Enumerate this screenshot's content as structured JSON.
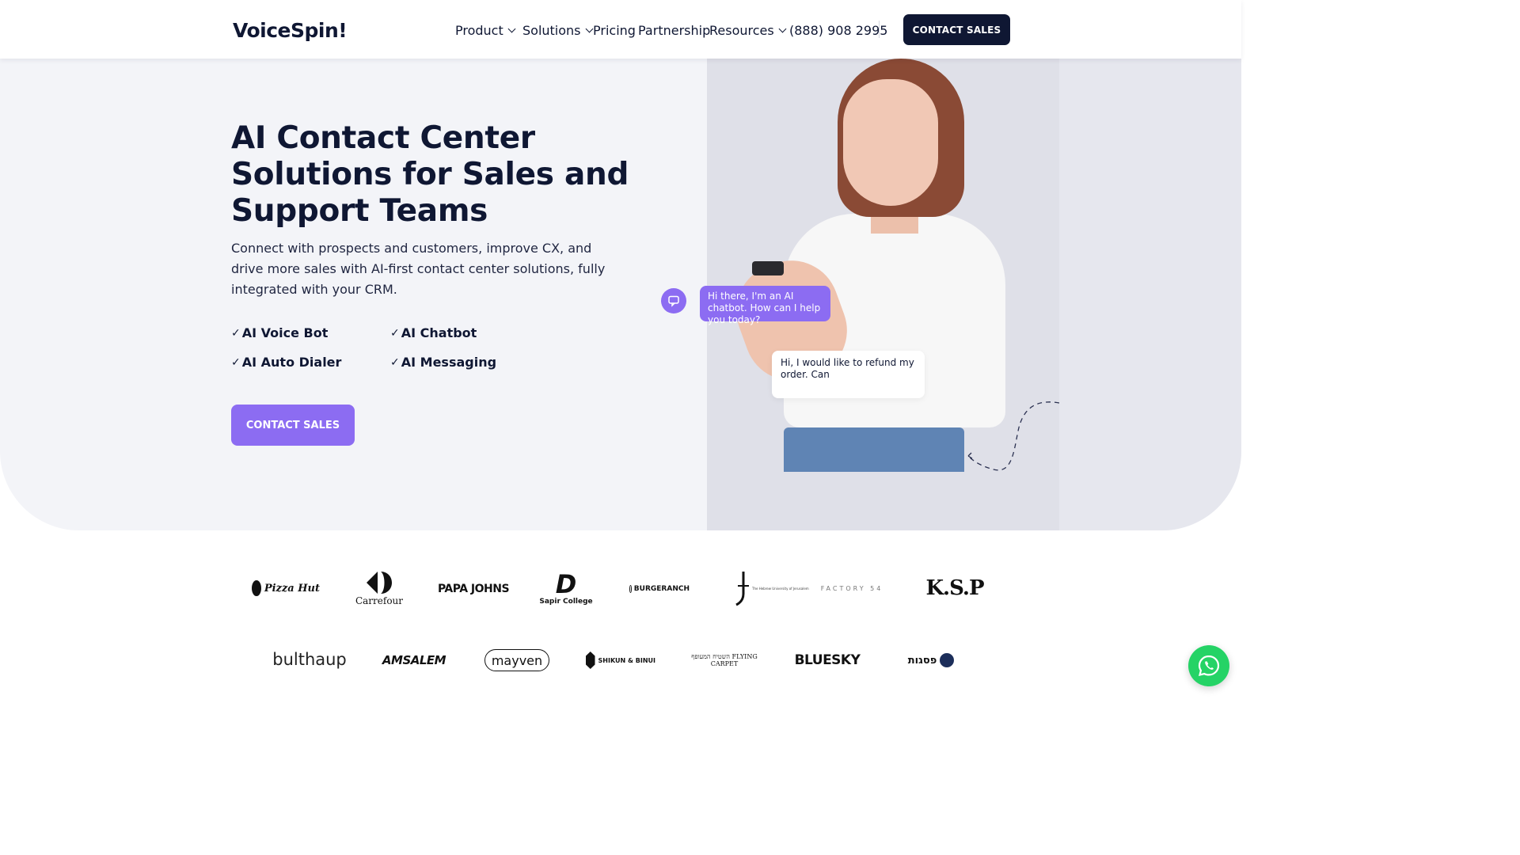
{
  "header": {
    "logo_text": "VoiceSpin!",
    "nav": [
      {
        "label": "Product",
        "has_dropdown": true
      },
      {
        "label": "Solutions",
        "has_dropdown": true
      },
      {
        "label": "Pricing",
        "has_dropdown": false
      },
      {
        "label": "Partnership",
        "has_dropdown": false
      },
      {
        "label": "Resources",
        "has_dropdown": true
      }
    ],
    "phone": "(888) 908 2995",
    "cta_label": "CONTACT SALES"
  },
  "hero": {
    "title": "AI Contact Center Solutions for Sales and Support Teams",
    "subtitle": "Connect with prospects and customers, improve CX, and drive more sales with AI-first contact center solutions, fully integrated with your CRM.",
    "features": [
      "AI Voice Bot",
      "AI Chatbot",
      "AI Auto Dialer",
      "AI Messaging"
    ],
    "check_glyph": "✓",
    "cta_label": "CONTACT SALES",
    "chat": {
      "bot_message": "Hi there, I'm an AI chatbot. How can I help you today?",
      "user_message": "Hi, I would like to refund my order.  Can"
    }
  },
  "clients": {
    "row1": [
      "Pizza Hut",
      "Carrefour",
      "PAPA JOHNS",
      "Sapir College",
      "BURGERANCH",
      "The Hebrew University of Jerusalem",
      "FACTORY 54",
      "K.S.P"
    ],
    "row2": [
      "bulthaup",
      "AMSALEM",
      "mayven",
      "SHIKUN & BINUI",
      "השטיח המעופף FLYING CARPET",
      "BLUESKY",
      "פסגות"
    ]
  },
  "colors": {
    "navy": "#0f1733",
    "purple": "#8c6cf2",
    "hero_bg": "#f3f4f8",
    "whatsapp": "#25d366"
  },
  "icons": {
    "chat": "chat-bubble-icon",
    "whatsapp": "whatsapp-icon",
    "chevron": "chevron-down-icon",
    "check": "check-icon"
  }
}
